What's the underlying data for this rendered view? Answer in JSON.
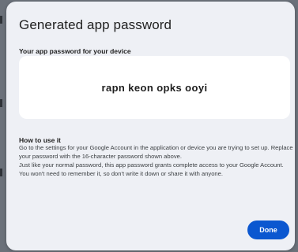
{
  "dialog": {
    "title": "Generated app password",
    "subtitle": "Your app password for your device",
    "password": "rapn keon opks ooyi",
    "howto_title": "How to use it",
    "howto_paragraph_1": "Go to the settings for your Google Account in the application or device you are trying to set up. Replace your password with the 16-character password shown above.",
    "howto_paragraph_2": "Just like your normal password, this app password grants complete access to your Google Account. You won't need to remember it, so don't write it down or share it with anyone.",
    "done_label": "Done"
  },
  "colors": {
    "accent": "#0b57d0",
    "dialog_background": "#eef0f5",
    "backdrop": "#6b717a"
  }
}
